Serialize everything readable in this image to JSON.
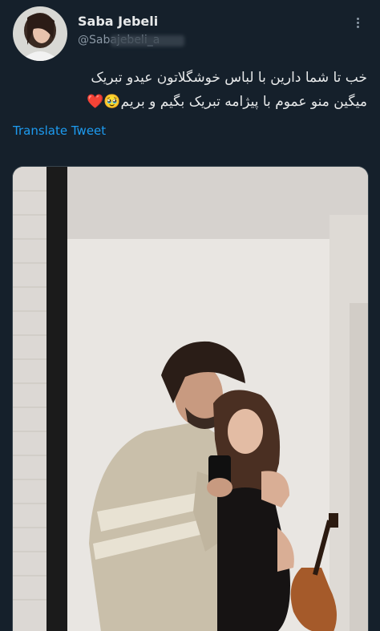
{
  "tweet": {
    "author": {
      "display_name": "Saba Jebeli",
      "handle": "@Sabajebeli_a"
    },
    "text_lines": [
      "خب تا شما دارین با لباس خوشگلاتون عیدو تبریک",
      "میگین منو عموم با پیژامه تبریک بگیم و بریم🥹❤️"
    ],
    "translate_label": "Translate Tweet",
    "more_icon": "more-dots-icon"
  },
  "media": {
    "description_icon": "photo"
  },
  "colors": {
    "background": "#15202b",
    "link": "#1d9bf0",
    "secondary_text": "#8b98a5"
  }
}
